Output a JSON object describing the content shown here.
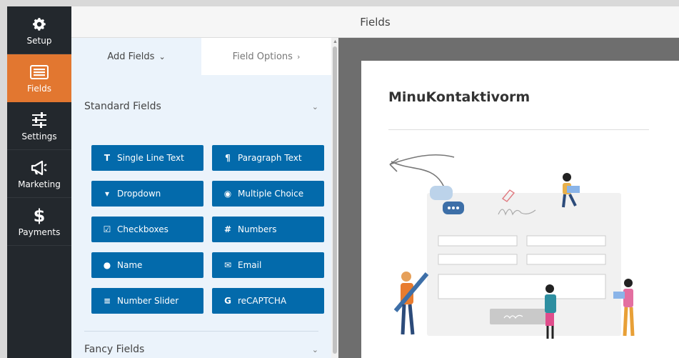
{
  "nav": [
    {
      "label": "Setup",
      "icon": "gear-icon"
    },
    {
      "label": "Fields",
      "icon": "fields-list-icon",
      "active": true
    },
    {
      "label": "Settings",
      "icon": "sliders-icon"
    },
    {
      "label": "Marketing",
      "icon": "megaphone-icon"
    },
    {
      "label": "Payments",
      "icon": "dollar-icon"
    }
  ],
  "header": {
    "title": "Fields"
  },
  "panel": {
    "tabs": [
      {
        "label": "Add Fields",
        "chevron": "⌄"
      },
      {
        "label": "Field Options",
        "chevron": "›"
      }
    ],
    "standard": {
      "title": "Standard Fields",
      "caret": "⌄",
      "buttons": [
        {
          "label": "Single Line Text",
          "icon": "T"
        },
        {
          "label": "Paragraph Text",
          "icon": "¶"
        },
        {
          "label": "Dropdown",
          "icon": "▾"
        },
        {
          "label": "Multiple Choice",
          "icon": "◉"
        },
        {
          "label": "Checkboxes",
          "icon": "☑"
        },
        {
          "label": "Numbers",
          "icon": "#"
        },
        {
          "label": "Name",
          "icon": "●"
        },
        {
          "label": "Email",
          "icon": "✉"
        },
        {
          "label": "Number Slider",
          "icon": "≡"
        },
        {
          "label": "reCAPTCHA",
          "icon": "G"
        }
      ]
    },
    "fancy": {
      "title": "Fancy Fields",
      "caret": "⌄"
    }
  },
  "preview": {
    "form_title": "MinuKontaktivorm"
  },
  "colors": {
    "accent": "#e27730",
    "button": "#036aab",
    "nav_bg": "#23282d",
    "panel_bg": "#ebf3fb"
  }
}
